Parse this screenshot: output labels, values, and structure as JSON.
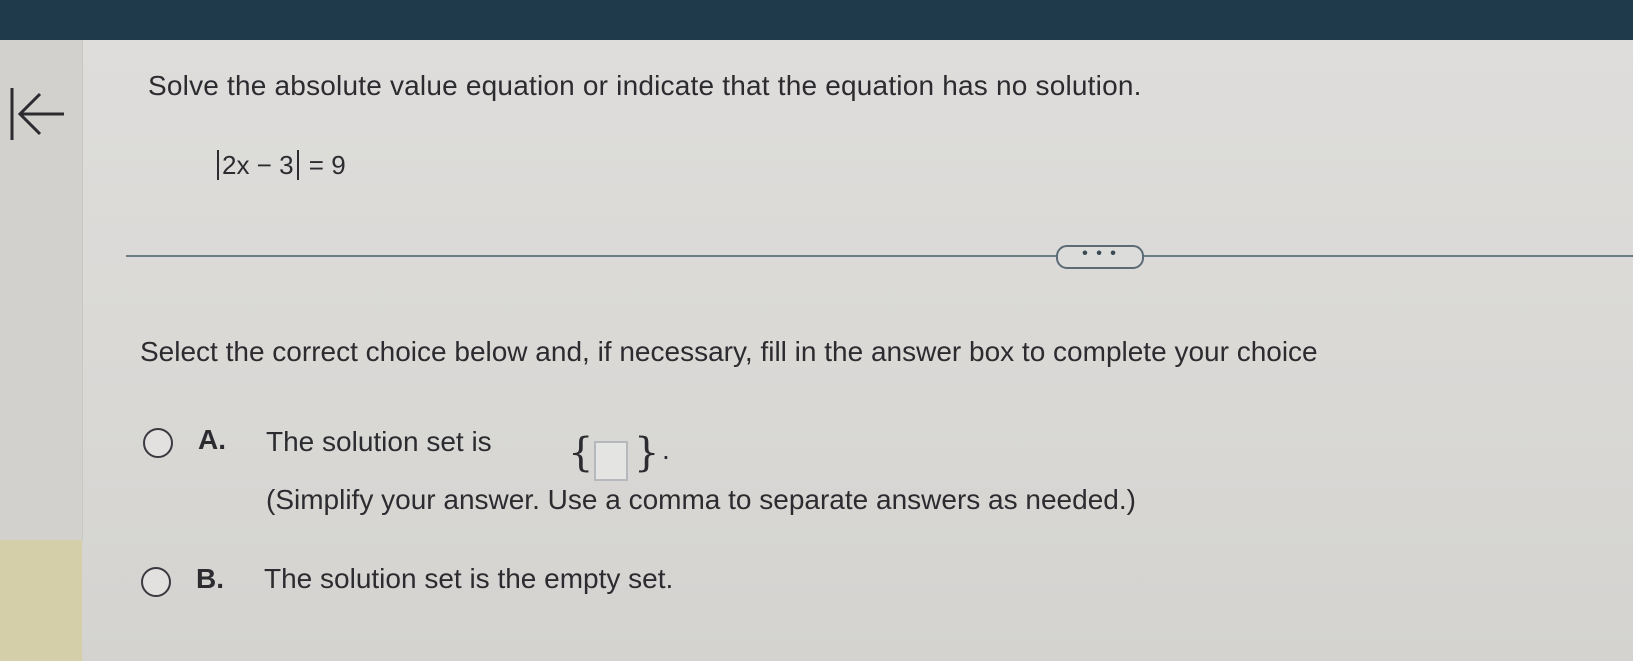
{
  "header": {
    "back_icon": "arrow-left-icon",
    "bar_color": "#1f3a4a"
  },
  "question": {
    "title": "Solve the absolute value equation or indicate that the equation has no solution.",
    "equation_inner": "2x − 3",
    "equation_rhs": "= 9"
  },
  "divider": {
    "expand_label": "• • •"
  },
  "instruction": "Select the correct choice below and, if necessary, fill in the answer box to complete your choice",
  "choices": [
    {
      "letter": "A.",
      "text": "The solution set is",
      "open_brace": "{",
      "close_brace": "}",
      "period": ".",
      "answer_value": "",
      "hint": "(Simplify your answer. Use a comma to separate answers as needed.)"
    },
    {
      "letter": "B.",
      "text": "The solution set is the empty set."
    }
  ]
}
